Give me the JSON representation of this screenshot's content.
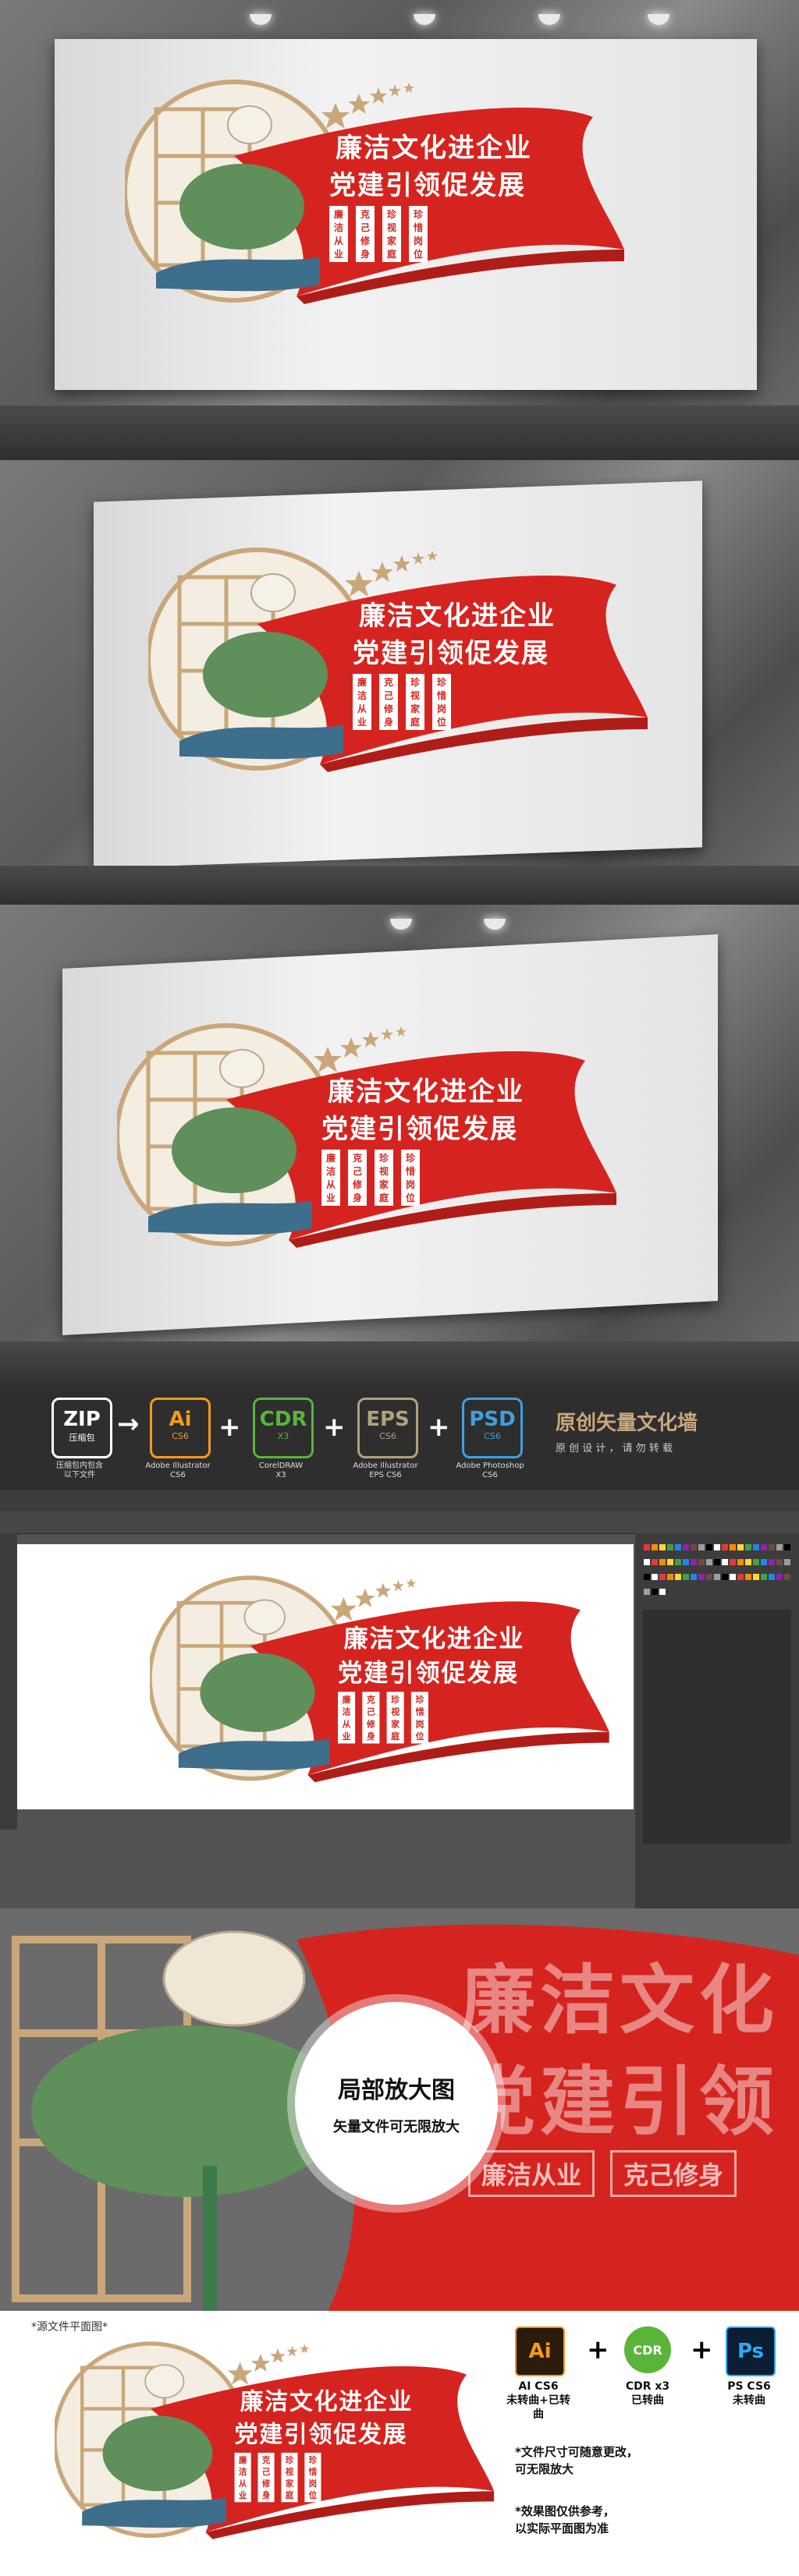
{
  "design": {
    "line1": "廉洁文化进企业",
    "line2": "党建引领促发展",
    "tags": [
      "廉洁从业",
      "克己修身",
      "珍视家庭",
      "珍惜岗位"
    ],
    "colors": {
      "red": "#d5241f",
      "gold": "#c9a77a",
      "green": "#3d7a4c"
    }
  },
  "formats": [
    {
      "name": "ZIP",
      "sub": "压缩包",
      "caption": "压缩包内包含\n以下文件",
      "color": "#ffffff"
    },
    {
      "name": "Ai",
      "sub": "CS6",
      "caption": "Adobe Illustrator\nCS6",
      "color": "#f29a1d"
    },
    {
      "name": "CDR",
      "sub": "X3",
      "caption": "CorelDRAW\nX3",
      "color": "#5ab43a"
    },
    {
      "name": "EPS",
      "sub": "CS6",
      "caption": "Adobe Illustrator\nEPS CS6",
      "color": "#b0a27c"
    },
    {
      "name": "PSD",
      "sub": "CS6",
      "caption": "Adobe Photoshop\nCS6",
      "color": "#3fa0e0"
    }
  ],
  "strip": {
    "title": "原创矢量文化墙",
    "subtitle": "原 创 设 计 ， 请 勿 转 载"
  },
  "zoom": {
    "title": "局部放大图",
    "subtitle": "矢量文件可无限放大",
    "bg_line1": "廉洁文化",
    "bg_line2": "党建引领",
    "bg_tags": [
      "廉洁从业",
      "克己修身"
    ]
  },
  "bottom": {
    "label": "*源文件平面图*",
    "apps": [
      {
        "icon": "Ai",
        "caption": "AI CS6\n未转曲+已转曲"
      },
      {
        "icon": "CDR",
        "caption": "CDR x3\n已转曲"
      },
      {
        "icon": "Ps",
        "caption": "PS CS6\n未转曲"
      }
    ],
    "notes": [
      "*文件尺寸可随意更改，\n  可无限放大",
      "*效果图仅供参考，\n  以实际平面图为准"
    ]
  }
}
